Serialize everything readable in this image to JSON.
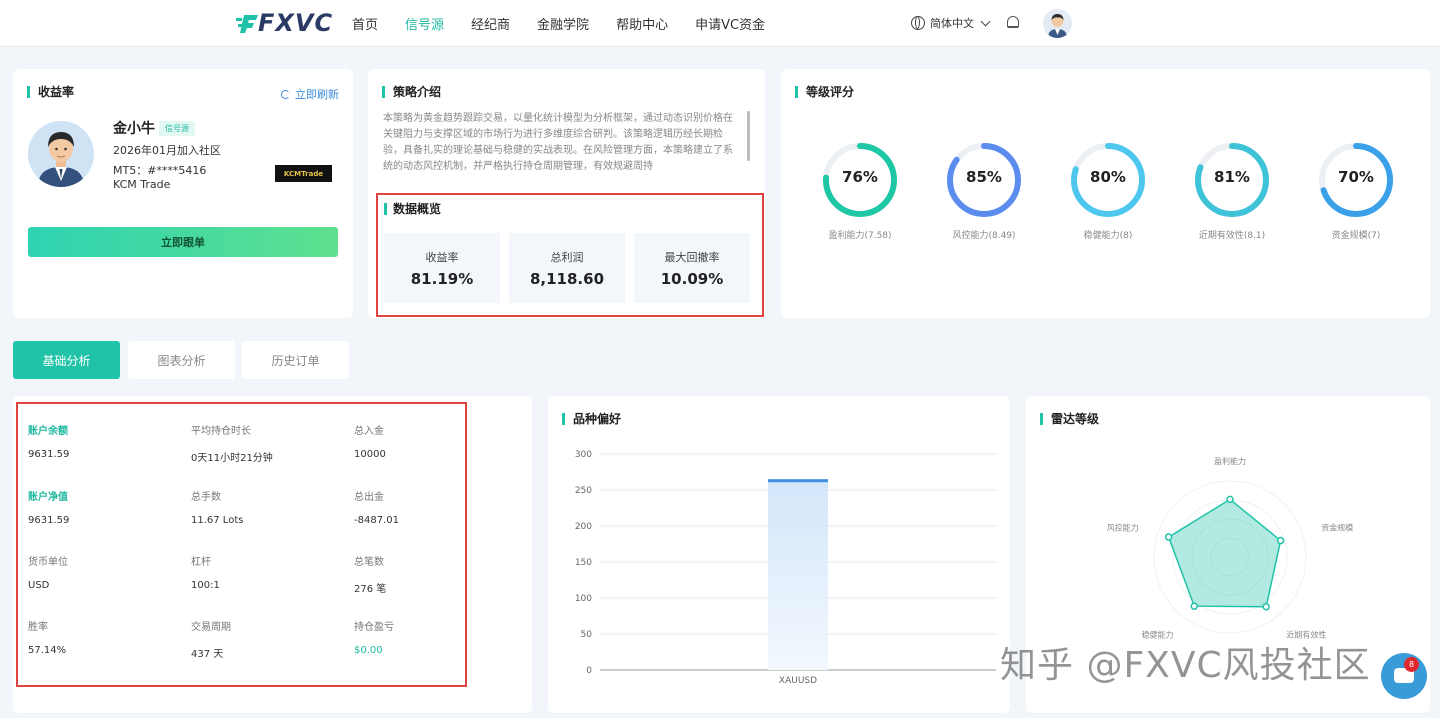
{
  "nav": {
    "logo": "FXVC",
    "items": [
      {
        "label": "首页",
        "active": false
      },
      {
        "label": "信号源",
        "active": true
      },
      {
        "label": "经纪商",
        "active": false
      },
      {
        "label": "金融学院",
        "active": false
      },
      {
        "label": "帮助中心",
        "active": false
      },
      {
        "label": "申请VC资金",
        "active": false
      }
    ],
    "language": "简体中文"
  },
  "profile": {
    "title": "收益率",
    "refresh_label": "立即刷新",
    "name": "金小牛",
    "badge": "信号源",
    "joined": "2026年01月加入社区",
    "mt5": "MT5：#****5416",
    "broker": "KCM Trade",
    "broker_logo_text": "KCMTrade",
    "follow_label": "立即跟单"
  },
  "strategy": {
    "title": "策略介绍",
    "text": "本策略为黄金趋势跟踪交易，以量化统计模型为分析框架，通过动态识别价格在关键阻力与支撑区域的市场行为进行多维度综合研判。该策略逻辑历经长期检验，具备扎实的理论基础与稳健的实战表现。在风险管理方面，本策略建立了系统的动态风控机制，并严格执行持仓周期管理，有效规避周持"
  },
  "overview": {
    "title": "数据概览",
    "stats": [
      {
        "label": "收益率",
        "value": "81.19%"
      },
      {
        "label": "总利润",
        "value": "8,118.60"
      },
      {
        "label": "最大回撤率",
        "value": "10.09%"
      }
    ]
  },
  "rating": {
    "title": "等级评分",
    "gauges": [
      {
        "value": "76%",
        "percent": 76,
        "label": "盈利能力(7.58)",
        "color": "#1fc8a4"
      },
      {
        "value": "85%",
        "percent": 85,
        "label": "风控能力(8.49)",
        "color": "#5b8def"
      },
      {
        "value": "80%",
        "percent": 80,
        "label": "稳健能力(8)",
        "color": "#4ec7ef"
      },
      {
        "value": "81%",
        "percent": 81,
        "label": "近期有效性(8.1)",
        "color": "#3fc3d8"
      },
      {
        "value": "70%",
        "percent": 70,
        "label": "资金规模(7)",
        "color": "#3aa0e8"
      }
    ]
  },
  "tabs": [
    {
      "label": "基础分析",
      "active": true
    },
    {
      "label": "图表分析",
      "active": false
    },
    {
      "label": "历史订单",
      "active": false
    }
  ],
  "account": {
    "fields": [
      {
        "label": "账户余额",
        "value": "9631.59",
        "highlight": true
      },
      {
        "label": "平均持仓时长",
        "value": "0天11小时21分钟"
      },
      {
        "label": "总入金",
        "value": "10000"
      },
      {
        "label": "账户净值",
        "value": "9631.59",
        "highlight": true
      },
      {
        "label": "总手数",
        "value": "11.67 Lots"
      },
      {
        "label": "总出金",
        "value": "-8487.01"
      },
      {
        "label": "货币单位",
        "value": "USD"
      },
      {
        "label": "杠杆",
        "value": "100:1"
      },
      {
        "label": "总笔数",
        "value": "276 笔"
      },
      {
        "label": "胜率",
        "value": "57.14%"
      },
      {
        "label": "交易周期",
        "value": "437 天"
      },
      {
        "label": "持仓盈亏",
        "value": "$0.00",
        "value_green": true
      }
    ]
  },
  "variety": {
    "title": "品种偏好",
    "chart_data": {
      "type": "bar",
      "categories": [
        "XAUUSD"
      ],
      "values": [
        265
      ],
      "ylim": [
        0,
        300
      ],
      "yticks": [
        0,
        50,
        100,
        150,
        200,
        250,
        300
      ],
      "grid": true
    }
  },
  "radar": {
    "title": "雷达等级",
    "chart_data": {
      "type": "radar",
      "axes": [
        "盈利能力",
        "资金规模",
        "近期有效性",
        "稳健能力",
        "风控能力"
      ],
      "values": [
        7.58,
        7,
        8.1,
        8,
        8.49
      ],
      "max": 10
    }
  },
  "watermark": "知乎 @FXVC风投社区",
  "chat_badge": "8"
}
